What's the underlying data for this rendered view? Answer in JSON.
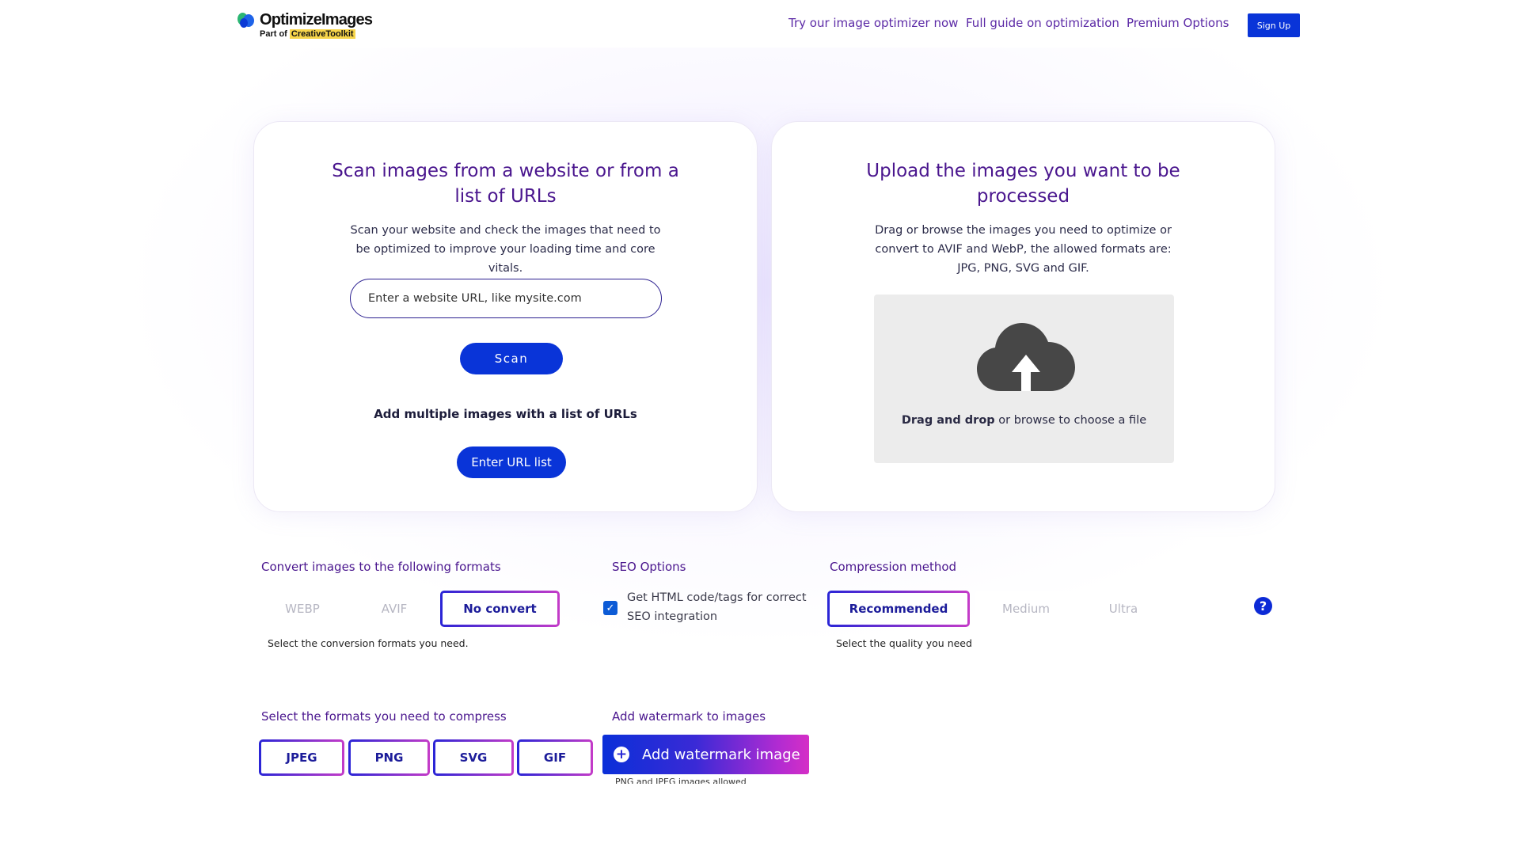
{
  "header": {
    "logo_name": "OptimizeImages",
    "logo_sub_prefix": "Part of ",
    "logo_sub_brand": "CreativeToolkit",
    "nav": [
      {
        "label": "Try our image optimizer now"
      },
      {
        "label": "Full guide on optimization"
      },
      {
        "label": "Premium Options"
      }
    ],
    "signup_label": "Sign Up"
  },
  "scan_card": {
    "title": "Scan images from a website or from a list of URLs",
    "description": "Scan your website and check the images that need to be optimized to improve your loading time and core vitals.",
    "url_placeholder": "Enter a website URL, like mysite.com",
    "scan_label": "Scan",
    "multi_label": "Add multiple images with a list of URLs",
    "url_list_label": "Enter URL list"
  },
  "upload_card": {
    "title": "Upload the images you want to be processed",
    "description": "Drag or browse the images you need to optimize or convert to AVIF and WebP, the allowed formats are: JPG, PNG, SVG and GIF.",
    "drop_bold": "Drag and drop",
    "drop_rest": " or browse to choose a file",
    "icon": "cloud-upload-icon"
  },
  "convert": {
    "label": "Convert images to the following formats",
    "options": [
      {
        "label": "WEBP",
        "selected": false
      },
      {
        "label": "AVIF",
        "selected": false
      },
      {
        "label": "No convert",
        "selected": true
      }
    ],
    "note": "Select the conversion formats you need."
  },
  "seo": {
    "label": "SEO Options",
    "checkbox_checked": true,
    "checkbox_text": "Get HTML code/tags for correct SEO integration"
  },
  "compression": {
    "label": "Compression method",
    "options": [
      {
        "label": "Recommended",
        "selected": true
      },
      {
        "label": "Medium",
        "selected": false
      },
      {
        "label": "Ultra",
        "selected": false
      }
    ],
    "note": "Select the quality you need",
    "help_icon": "question-icon"
  },
  "compress_formats": {
    "label": "Select the formats you need to compress",
    "options": [
      {
        "label": "JPEG",
        "selected": true
      },
      {
        "label": "PNG",
        "selected": true
      },
      {
        "label": "SVG",
        "selected": true
      },
      {
        "label": "GIF",
        "selected": true
      }
    ]
  },
  "watermark": {
    "label": "Add watermark to images",
    "button_label": "Add watermark image",
    "note": "PNG and JPEG images allowed"
  },
  "colors": {
    "primary_blue": "#0934d8",
    "heading_purple": "#4a168e",
    "gradient_end": "#d52fc6"
  }
}
